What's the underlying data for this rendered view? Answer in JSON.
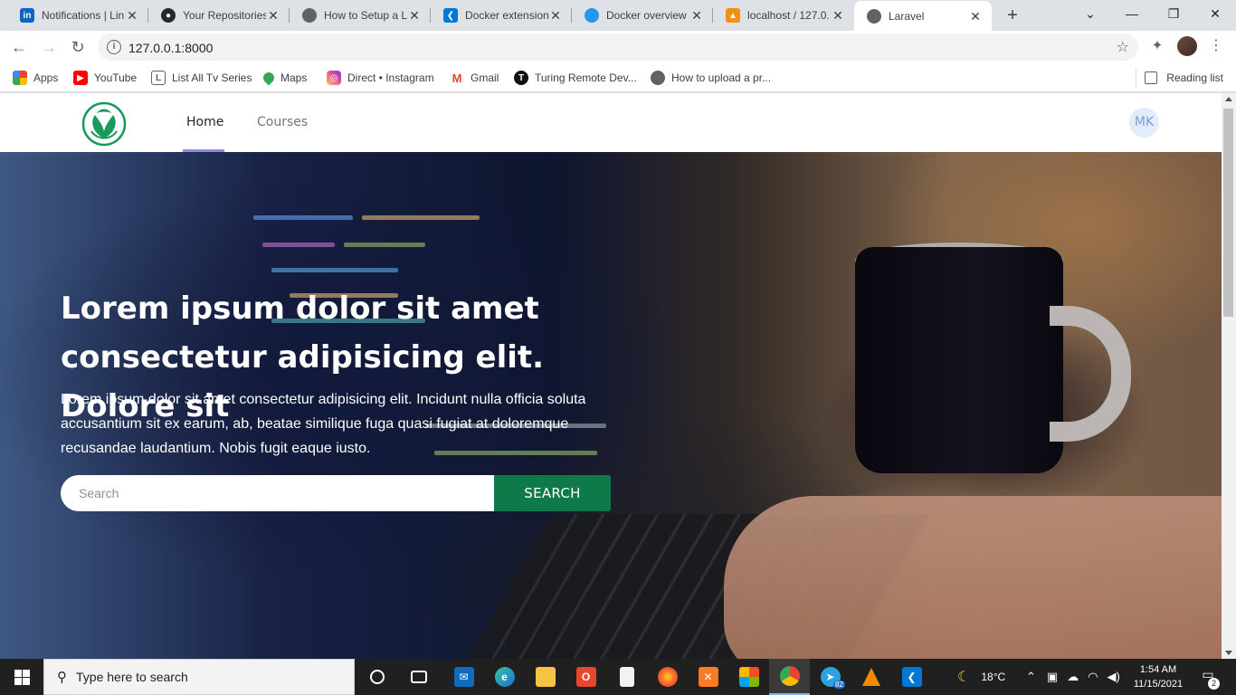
{
  "browser": {
    "tabs": [
      {
        "title": "Notifications | Lin",
        "favicon": "linkedin-icon",
        "color": "#0a66c2"
      },
      {
        "title": "Your Repositories",
        "favicon": "github-icon",
        "color": "#24292e"
      },
      {
        "title": "How to Setup a L",
        "favicon": "globe-icon",
        "color": "#5f6368"
      },
      {
        "title": "Docker extension",
        "favicon": "vscode-icon",
        "color": "#0078d4"
      },
      {
        "title": "Docker overview",
        "favicon": "docker-docs-icon",
        "color": "#2496ed"
      },
      {
        "title": "localhost / 127.0.",
        "favicon": "phpmyadmin-icon",
        "color": "#f29111"
      },
      {
        "title": "Laravel",
        "favicon": "globe-icon",
        "color": "#5f6368"
      }
    ],
    "active_tab": 6,
    "url": "127.0.0.1:8000",
    "bookmarks": [
      {
        "label": "Apps",
        "icon": "apps-grid-icon"
      },
      {
        "label": "YouTube",
        "icon": "youtube-icon"
      },
      {
        "label": "List All Tv Series",
        "icon": "tv-icon"
      },
      {
        "label": "Maps",
        "icon": "maps-pin-icon"
      },
      {
        "label": "Direct • Instagram",
        "icon": "instagram-icon"
      },
      {
        "label": "Gmail",
        "icon": "gmail-icon"
      },
      {
        "label": "Turing Remote Dev...",
        "icon": "turing-icon"
      },
      {
        "label": "How to upload a pr...",
        "icon": "globe-icon"
      }
    ],
    "reading_list": "Reading list"
  },
  "site": {
    "nav": {
      "home": "Home",
      "courses": "Courses",
      "avatar_initials": "MK"
    },
    "hero": {
      "title": "Lorem ipsum dolor sit amet consectetur adipisicing elit. Dolore sit",
      "subtitle": "Lorem ipsum dolor sit amet consectetur adipisicing elit. Incidunt nulla officia soluta accusantium sit ex earum, ab, beatae similique fuga quasi fugiat at doloremque recusandae laudantium. Nobis fugit eaque iusto.",
      "search_placeholder": "Search",
      "search_button": "SEARCH"
    },
    "colors": {
      "brand_green": "#0e7a4a",
      "nav_active_underline": "#8a8fe0"
    }
  },
  "taskbar": {
    "search_placeholder": "Type here to search",
    "apps": [
      {
        "name": "task-view-icon"
      },
      {
        "name": "mail-icon"
      },
      {
        "name": "edge-icon"
      },
      {
        "name": "file-explorer-icon"
      },
      {
        "name": "office-icon"
      },
      {
        "name": "notepad-icon"
      },
      {
        "name": "firefox-icon"
      },
      {
        "name": "xampp-icon"
      },
      {
        "name": "store-icon"
      },
      {
        "name": "chrome-icon"
      },
      {
        "name": "telegram-icon",
        "badge": "82"
      },
      {
        "name": "vlc-icon"
      },
      {
        "name": "vscode-icon"
      }
    ],
    "weather": "18°C",
    "time": "1:54 AM",
    "date": "11/15/2021",
    "notifications": "2"
  }
}
